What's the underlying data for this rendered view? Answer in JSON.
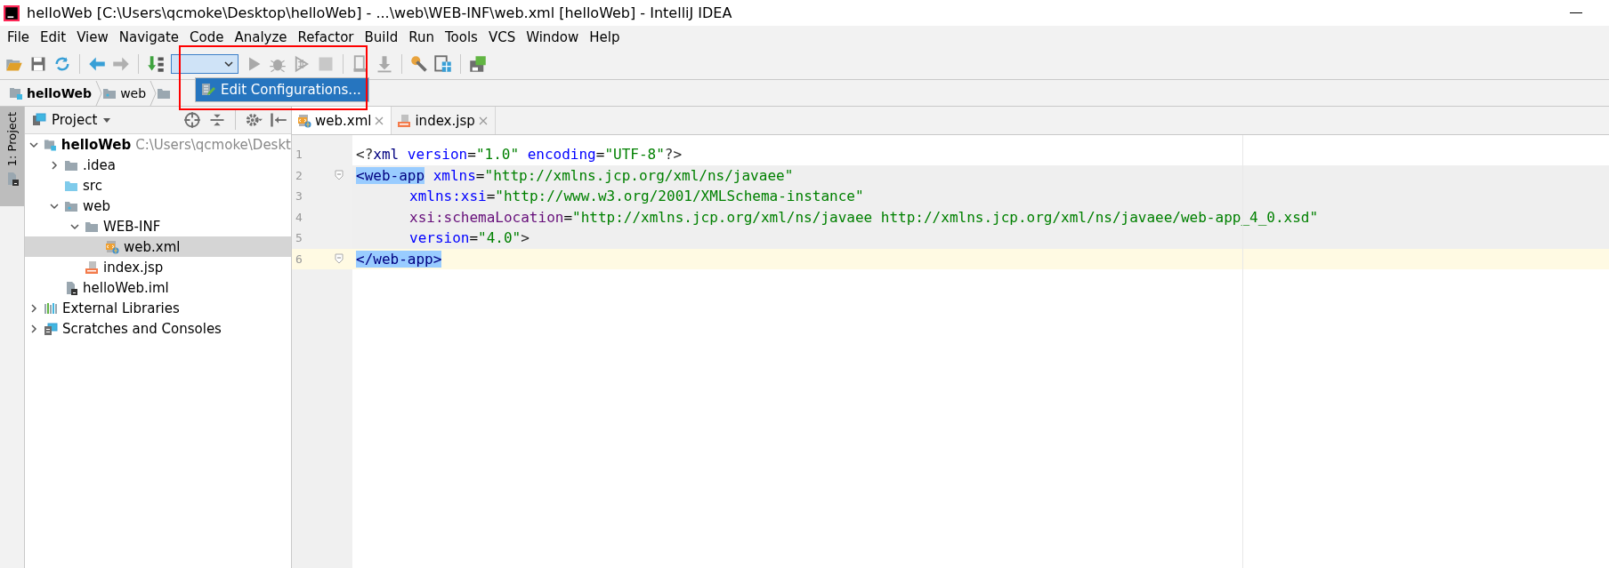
{
  "window": {
    "title": "helloWeb [C:\\Users\\qcmoke\\Desktop\\helloWeb] - ...\\web\\WEB-INF\\web.xml [helloWeb] - IntelliJ IDEA"
  },
  "menu": [
    {
      "label": "File"
    },
    {
      "label": "Edit"
    },
    {
      "label": "View"
    },
    {
      "label": "Navigate"
    },
    {
      "label": "Code"
    },
    {
      "label": "Analyze"
    },
    {
      "label": "Refactor"
    },
    {
      "label": "Build"
    },
    {
      "label": "Run"
    },
    {
      "label": "Tools"
    },
    {
      "label": "VCS"
    },
    {
      "label": "Window"
    },
    {
      "label": "Help"
    }
  ],
  "popup": {
    "items": [
      {
        "label": "Edit Configurations...",
        "selected": true
      }
    ]
  },
  "breadcrumbs": [
    {
      "label": "helloWeb",
      "kind": "module"
    },
    {
      "label": "web",
      "kind": "web-folder"
    },
    {
      "kind": "folder"
    }
  ],
  "side_stripe": {
    "label": "1: Project",
    "selected": true
  },
  "project_panel": {
    "title": "Project",
    "tree": [
      {
        "label": "helloWeb",
        "hint": "C:\\Users\\qcmoke\\Deskt",
        "kind": "module",
        "expanded": true,
        "selected": false,
        "children": [
          {
            "label": ".idea",
            "kind": "folder",
            "expanded": false,
            "selected": false
          },
          {
            "label": "src",
            "kind": "source-folder",
            "selected": false
          },
          {
            "label": "web",
            "kind": "web-folder",
            "expanded": true,
            "selected": false,
            "children": [
              {
                "label": "WEB-INF",
                "kind": "folder",
                "expanded": true,
                "selected": false,
                "children": [
                  {
                    "label": "web.xml",
                    "kind": "xml",
                    "selected": true
                  }
                ]
              },
              {
                "label": "index.jsp",
                "kind": "jsp",
                "selected": false
              }
            ]
          },
          {
            "label": "helloWeb.iml",
            "kind": "iml",
            "selected": false
          }
        ]
      },
      {
        "label": "External Libraries",
        "kind": "libraries",
        "expanded": false,
        "selected": false
      },
      {
        "label": "Scratches and Consoles",
        "kind": "scratches",
        "expanded": false,
        "selected": false
      }
    ]
  },
  "editor": {
    "tabs": [
      {
        "label": "web.xml",
        "kind": "xml",
        "selected": true
      },
      {
        "label": "index.jsp",
        "kind": "jsp",
        "selected": false
      }
    ],
    "lines": [
      {
        "number": "1",
        "kind": "plain",
        "fold": false,
        "indent": false,
        "tokens": [
          {
            "t": "<?",
            "kind": "punct"
          },
          {
            "t": "xml",
            "kind": "tag"
          },
          {
            "t": " version",
            "kind": "attr"
          },
          {
            "t": "=",
            "kind": "plain"
          },
          {
            "t": "\"1.0\"",
            "kind": "value"
          },
          {
            "t": " encoding",
            "kind": "attr"
          },
          {
            "t": "=",
            "kind": "plain"
          },
          {
            "t": "\"UTF-8\"",
            "kind": "value"
          },
          {
            "t": "?>",
            "kind": "punct"
          }
        ]
      },
      {
        "number": "2",
        "kind": "scope",
        "fold": true,
        "indent": false,
        "tokens": [
          {
            "t": "<web-app",
            "kind": "matched"
          },
          {
            "t": " xmlns",
            "kind": "attr"
          },
          {
            "t": "=",
            "kind": "plain"
          },
          {
            "t": "\"http://xmlns.jcp.org/xml/ns/javaee\"",
            "kind": "value"
          }
        ]
      },
      {
        "number": "3",
        "kind": "scope",
        "fold": false,
        "indent": true,
        "tokens": [
          {
            "t": "xmlns:xsi",
            "kind": "attr"
          },
          {
            "t": "=",
            "kind": "plain"
          },
          {
            "t": "\"http://www.w3.org/2001/XMLSchema-instance\"",
            "kind": "value"
          }
        ]
      },
      {
        "number": "4",
        "kind": "scope",
        "fold": false,
        "indent": true,
        "tokens": [
          {
            "t": "xsi:schemaLocation",
            "kind": "ns-attr"
          },
          {
            "t": "=",
            "kind": "plain"
          },
          {
            "t": "\"http://xmlns.jcp.org/xml/ns/javaee http://xmlns.jcp.org/xml/ns/javaee/web-app_4_0.xsd\"",
            "kind": "value"
          }
        ]
      },
      {
        "number": "5",
        "kind": "scope",
        "fold": false,
        "indent": true,
        "tokens": [
          {
            "t": "version",
            "kind": "attr"
          },
          {
            "t": "=",
            "kind": "plain"
          },
          {
            "t": "\"4.0\"",
            "kind": "value"
          },
          {
            "t": ">",
            "kind": "punct"
          }
        ]
      },
      {
        "number": "6",
        "kind": "caret",
        "fold": true,
        "indent": false,
        "tokens": [
          {
            "t": "</web-app>",
            "kind": "matched"
          }
        ]
      }
    ]
  }
}
